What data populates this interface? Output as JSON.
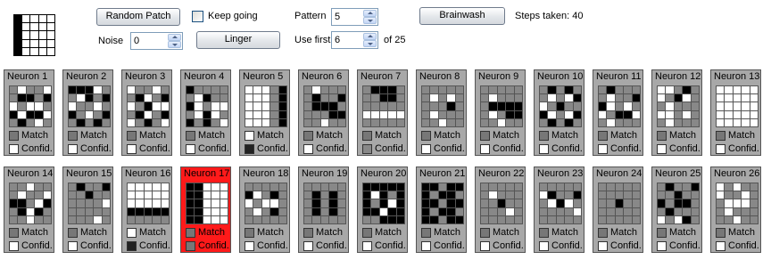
{
  "controls": {
    "random_patch_label": "Random Patch",
    "keep_going_label": "Keep going",
    "keep_going_checked": false,
    "pattern_label": "Pattern",
    "pattern_value": "5",
    "brainwash_label": "Brainwash",
    "steps_text": "Steps taken: 40",
    "noise_label": "Noise",
    "noise_value": "0",
    "linger_label": "Linger",
    "use_first_label": "Use first",
    "use_first_value": "6",
    "of_total_text": "of 25"
  },
  "preview_pattern": [
    "#000000",
    "#ffffff",
    "#ffffff",
    "#ffffff",
    "#ffffff",
    "#000000",
    "#ffffff",
    "#ffffff",
    "#ffffff",
    "#ffffff",
    "#000000",
    "#ffffff",
    "#ffffff",
    "#ffffff",
    "#ffffff",
    "#000000",
    "#ffffff",
    "#ffffff",
    "#ffffff",
    "#ffffff",
    "#000000",
    "#ffffff",
    "#ffffff",
    "#ffffff",
    "#ffffff"
  ],
  "colors": {
    "panel": "#a8a8a8",
    "active_panel": "#ff1a1a"
  },
  "match_label": "Match",
  "confid_label": "Confid.",
  "neurons": [
    {
      "title": "Neuron 1",
      "active": false,
      "match": "#777777",
      "confid": "#ffffff",
      "cells": [
        "#888",
        "#fff",
        "#888",
        "#888",
        "#fff",
        "#888",
        "#000",
        "#000",
        "#888",
        "#000",
        "#fff",
        "#888",
        "#fff",
        "#fff",
        "#888",
        "#000",
        "#fff",
        "#000",
        "#000",
        "#fff",
        "#888",
        "#000",
        "#888",
        "#fff",
        "#888"
      ]
    },
    {
      "title": "Neuron 2",
      "active": false,
      "match": "#777777",
      "confid": "#ffffff",
      "cells": [
        "#000",
        "#000",
        "#000",
        "#fff",
        "#888",
        "#888",
        "#fff",
        "#000",
        "#888",
        "#000",
        "#fff",
        "#888",
        "#888",
        "#fff",
        "#888",
        "#000",
        "#888",
        "#fff",
        "#888",
        "#000",
        "#888",
        "#000",
        "#888",
        "#000",
        "#888"
      ]
    },
    {
      "title": "Neuron 3",
      "active": false,
      "match": "#777777",
      "confid": "#ffffff",
      "cells": [
        "#fff",
        "#888",
        "#888",
        "#fff",
        "#888",
        "#888",
        "#000",
        "#fff",
        "#888",
        "#000",
        "#fff",
        "#888",
        "#000",
        "#fff",
        "#fff",
        "#888",
        "#000",
        "#fff",
        "#888",
        "#000",
        "#fff",
        "#888",
        "#000",
        "#888",
        "#fff"
      ]
    },
    {
      "title": "Neuron 4",
      "active": false,
      "match": "#777777",
      "confid": "#ffffff",
      "cells": [
        "#000",
        "#888",
        "#888",
        "#888",
        "#888",
        "#888",
        "#fff",
        "#000",
        "#888",
        "#888",
        "#000",
        "#fff",
        "#888",
        "#fff",
        "#fff",
        "#888",
        "#fff",
        "#000",
        "#fff",
        "#888",
        "#000",
        "#888",
        "#000",
        "#888",
        "#fff"
      ]
    },
    {
      "title": "Neuron 5",
      "active": false,
      "match": "#ffffff",
      "confid": "#222222",
      "cells": [
        "#fff",
        "#fff",
        "#fff",
        "#888",
        "#000",
        "#fff",
        "#fff",
        "#fff",
        "#888",
        "#000",
        "#fff",
        "#fff",
        "#fff",
        "#888",
        "#000",
        "#fff",
        "#fff",
        "#fff",
        "#888",
        "#000",
        "#fff",
        "#fff",
        "#fff",
        "#888",
        "#000"
      ]
    },
    {
      "title": "Neuron 6",
      "active": false,
      "match": "#777777",
      "confid": "#ffffff",
      "cells": [
        "#888",
        "#fff",
        "#888",
        "#888",
        "#888",
        "#888",
        "#000",
        "#888",
        "#888",
        "#000",
        "#888",
        "#000",
        "#000",
        "#000",
        "#888",
        "#888",
        "#888",
        "#888",
        "#000",
        "#000",
        "#888",
        "#888",
        "#fff",
        "#888",
        "#888"
      ]
    },
    {
      "title": "Neuron 7",
      "active": false,
      "match": "#777777",
      "confid": "#888888",
      "cells": [
        "#888",
        "#000",
        "#000",
        "#000",
        "#888",
        "#888",
        "#888",
        "#000",
        "#000",
        "#888",
        "#888",
        "#888",
        "#888",
        "#888",
        "#888",
        "#fff",
        "#fff",
        "#fff",
        "#fff",
        "#fff",
        "#888",
        "#888",
        "#888",
        "#888",
        "#888"
      ]
    },
    {
      "title": "Neuron 8",
      "active": false,
      "match": "#777777",
      "confid": "#ffffff",
      "cells": [
        "#888",
        "#888",
        "#888",
        "#888",
        "#888",
        "#888",
        "#fff",
        "#888",
        "#fff",
        "#888",
        "#888",
        "#888",
        "#888",
        "#000",
        "#888",
        "#888",
        "#fff",
        "#888",
        "#888",
        "#888",
        "#888",
        "#888",
        "#fff",
        "#888",
        "#888"
      ]
    },
    {
      "title": "Neuron 9",
      "active": false,
      "match": "#777777",
      "confid": "#ffffff",
      "cells": [
        "#888",
        "#888",
        "#888",
        "#888",
        "#888",
        "#888",
        "#fff",
        "#888",
        "#888",
        "#888",
        "#888",
        "#000",
        "#000",
        "#000",
        "#000",
        "#888",
        "#fff",
        "#888",
        "#000",
        "#000",
        "#888",
        "#888",
        "#fff",
        "#888",
        "#888"
      ]
    },
    {
      "title": "Neuron 10",
      "active": false,
      "match": "#777777",
      "confid": "#ffffff",
      "cells": [
        "#888",
        "#000",
        "#888",
        "#000",
        "#888",
        "#888",
        "#fff",
        "#888",
        "#fff",
        "#000",
        "#fff",
        "#888",
        "#000",
        "#888",
        "#888",
        "#000",
        "#fff",
        "#888",
        "#fff",
        "#000",
        "#888",
        "#000",
        "#888",
        "#000",
        "#888"
      ]
    },
    {
      "title": "Neuron 11",
      "active": false,
      "match": "#777777",
      "confid": "#ffffff",
      "cells": [
        "#888",
        "#000",
        "#888",
        "#888",
        "#888",
        "#888",
        "#fff",
        "#888",
        "#888",
        "#000",
        "#000",
        "#fff",
        "#888",
        "#fff",
        "#888",
        "#fff",
        "#888",
        "#000",
        "#000",
        "#fff",
        "#888",
        "#fff",
        "#888",
        "#888",
        "#888"
      ]
    },
    {
      "title": "Neuron 12",
      "active": false,
      "match": "#777777",
      "confid": "#ffffff",
      "cells": [
        "#fff",
        "#fff",
        "#888",
        "#000",
        "#888",
        "#fff",
        "#888",
        "#000",
        "#fff",
        "#888",
        "#888",
        "#fff",
        "#888",
        "#888",
        "#888",
        "#fff",
        "#fff",
        "#888",
        "#fff",
        "#888",
        "#888",
        "#fff",
        "#888",
        "#888",
        "#888"
      ]
    },
    {
      "title": "Neuron 13",
      "active": false,
      "match": "#777777",
      "confid": "#ffffff",
      "cells": [
        "#fff",
        "#fff",
        "#fff",
        "#fff",
        "#fff",
        "#fff",
        "#fff",
        "#fff",
        "#fff",
        "#fff",
        "#fff",
        "#fff",
        "#fff",
        "#fff",
        "#fff",
        "#fff",
        "#fff",
        "#fff",
        "#fff",
        "#fff",
        "#fff",
        "#fff",
        "#fff",
        "#fff",
        "#fff"
      ]
    },
    {
      "title": "Neuron 14",
      "active": false,
      "match": "#777777",
      "confid": "#ffffff",
      "cells": [
        "#888",
        "#888",
        "#fff",
        "#888",
        "#888",
        "#888",
        "#fff",
        "#888",
        "#888",
        "#fff",
        "#000",
        "#000",
        "#888",
        "#fff",
        "#000",
        "#888",
        "#000",
        "#fff",
        "#000",
        "#888",
        "#888",
        "#888",
        "#fff",
        "#888",
        "#888"
      ]
    },
    {
      "title": "Neuron 15",
      "active": false,
      "match": "#777777",
      "confid": "#ffffff",
      "cells": [
        "#888",
        "#000",
        "#888",
        "#888",
        "#000",
        "#888",
        "#888",
        "#000",
        "#888",
        "#888",
        "#888",
        "#888",
        "#888",
        "#888",
        "#fff",
        "#888",
        "#888",
        "#888",
        "#888",
        "#888",
        "#888",
        "#888",
        "#888",
        "#fff",
        "#888"
      ]
    },
    {
      "title": "Neuron 16",
      "active": false,
      "match": "#ffffff",
      "confid": "#222222",
      "cells": [
        "#fff",
        "#fff",
        "#fff",
        "#fff",
        "#fff",
        "#fff",
        "#fff",
        "#fff",
        "#fff",
        "#fff",
        "#fff",
        "#fff",
        "#fff",
        "#fff",
        "#fff",
        "#000",
        "#000",
        "#000",
        "#000",
        "#000",
        "#888",
        "#888",
        "#888",
        "#888",
        "#888"
      ]
    },
    {
      "title": "Neuron 17",
      "active": true,
      "match": "#777777",
      "confid": "#777777",
      "cells": [
        "#000",
        "#000",
        "#fff",
        "#fff",
        "#fff",
        "#000",
        "#000",
        "#fff",
        "#fff",
        "#fff",
        "#000",
        "#000",
        "#fff",
        "#fff",
        "#fff",
        "#000",
        "#000",
        "#fff",
        "#fff",
        "#fff",
        "#000",
        "#000",
        "#fff",
        "#fff",
        "#fff"
      ]
    },
    {
      "title": "Neuron 18",
      "active": false,
      "match": "#777777",
      "confid": "#ffffff",
      "cells": [
        "#888",
        "#888",
        "#888",
        "#888",
        "#888",
        "#000",
        "#fff",
        "#888",
        "#000",
        "#888",
        "#fff",
        "#888",
        "#fff",
        "#fff",
        "#888",
        "#888",
        "#fff",
        "#888",
        "#000",
        "#888",
        "#888",
        "#888",
        "#888",
        "#888",
        "#888"
      ]
    },
    {
      "title": "Neuron 19",
      "active": false,
      "match": "#777777",
      "confid": "#ffffff",
      "cells": [
        "#888",
        "#888",
        "#888",
        "#888",
        "#888",
        "#888",
        "#000",
        "#888",
        "#000",
        "#888",
        "#888",
        "#000",
        "#888",
        "#000",
        "#888",
        "#888",
        "#000",
        "#888",
        "#000",
        "#888",
        "#888",
        "#888",
        "#888",
        "#888",
        "#888"
      ]
    },
    {
      "title": "Neuron 20",
      "active": false,
      "match": "#777777",
      "confid": "#ffffff",
      "cells": [
        "#000",
        "#000",
        "#000",
        "#000",
        "#000",
        "#000",
        "#fff",
        "#000",
        "#888",
        "#000",
        "#000",
        "#888",
        "#000",
        "#fff",
        "#000",
        "#000",
        "#000",
        "#fff",
        "#000",
        "#000",
        "#888",
        "#888",
        "#000",
        "#000",
        "#000"
      ]
    },
    {
      "title": "Neuron 21",
      "active": false,
      "match": "#777777",
      "confid": "#ffffff",
      "cells": [
        "#000",
        "#000",
        "#888",
        "#000",
        "#000",
        "#000",
        "#888",
        "#000",
        "#000",
        "#888",
        "#000",
        "#000",
        "#888",
        "#000",
        "#000",
        "#000",
        "#888",
        "#000",
        "#000",
        "#888",
        "#000",
        "#000",
        "#888",
        "#000",
        "#000"
      ]
    },
    {
      "title": "Neuron 22",
      "active": false,
      "match": "#777777",
      "confid": "#ffffff",
      "cells": [
        "#888",
        "#888",
        "#888",
        "#888",
        "#888",
        "#888",
        "#fff",
        "#888",
        "#888",
        "#888",
        "#888",
        "#888",
        "#000",
        "#888",
        "#888",
        "#888",
        "#888",
        "#888",
        "#fff",
        "#888",
        "#888",
        "#888",
        "#888",
        "#888",
        "#888"
      ]
    },
    {
      "title": "Neuron 23",
      "active": false,
      "match": "#777777",
      "confid": "#ffffff",
      "cells": [
        "#888",
        "#888",
        "#888",
        "#888",
        "#888",
        "#fff",
        "#000",
        "#888",
        "#888",
        "#000",
        "#888",
        "#fff",
        "#000",
        "#fff",
        "#888",
        "#888",
        "#888",
        "#888",
        "#888",
        "#fff",
        "#888",
        "#888",
        "#888",
        "#888",
        "#888"
      ]
    },
    {
      "title": "Neuron 24",
      "active": false,
      "match": "#777777",
      "confid": "#ffffff",
      "cells": [
        "#888",
        "#888",
        "#888",
        "#888",
        "#888",
        "#888",
        "#888",
        "#888",
        "#888",
        "#888",
        "#888",
        "#888",
        "#000",
        "#888",
        "#888",
        "#888",
        "#888",
        "#888",
        "#888",
        "#888",
        "#888",
        "#888",
        "#888",
        "#888",
        "#888"
      ]
    },
    {
      "title": "Neuron 25",
      "active": false,
      "match": "#777777",
      "confid": "#ffffff",
      "cells": [
        "#888",
        "#000",
        "#888",
        "#888",
        "#000",
        "#888",
        "#888",
        "#000",
        "#888",
        "#888",
        "#000",
        "#888",
        "#000",
        "#000",
        "#888",
        "#888",
        "#000",
        "#888",
        "#888",
        "#888",
        "#fff",
        "#888",
        "#fff",
        "#000",
        "#888"
      ]
    },
    {
      "title": "Neuron 26",
      "active": false,
      "match": "#777777",
      "confid": "#ffffff",
      "cells": [
        "#fff",
        "#888",
        "#fff",
        "#888",
        "#888",
        "#fff",
        "#888",
        "#888",
        "#fff",
        "#888",
        "#888",
        "#fff",
        "#fff",
        "#fff",
        "#888",
        "#888",
        "#fff",
        "#888",
        "#888",
        "#888",
        "#888",
        "#888",
        "#fff",
        "#888",
        "#888"
      ]
    }
  ]
}
